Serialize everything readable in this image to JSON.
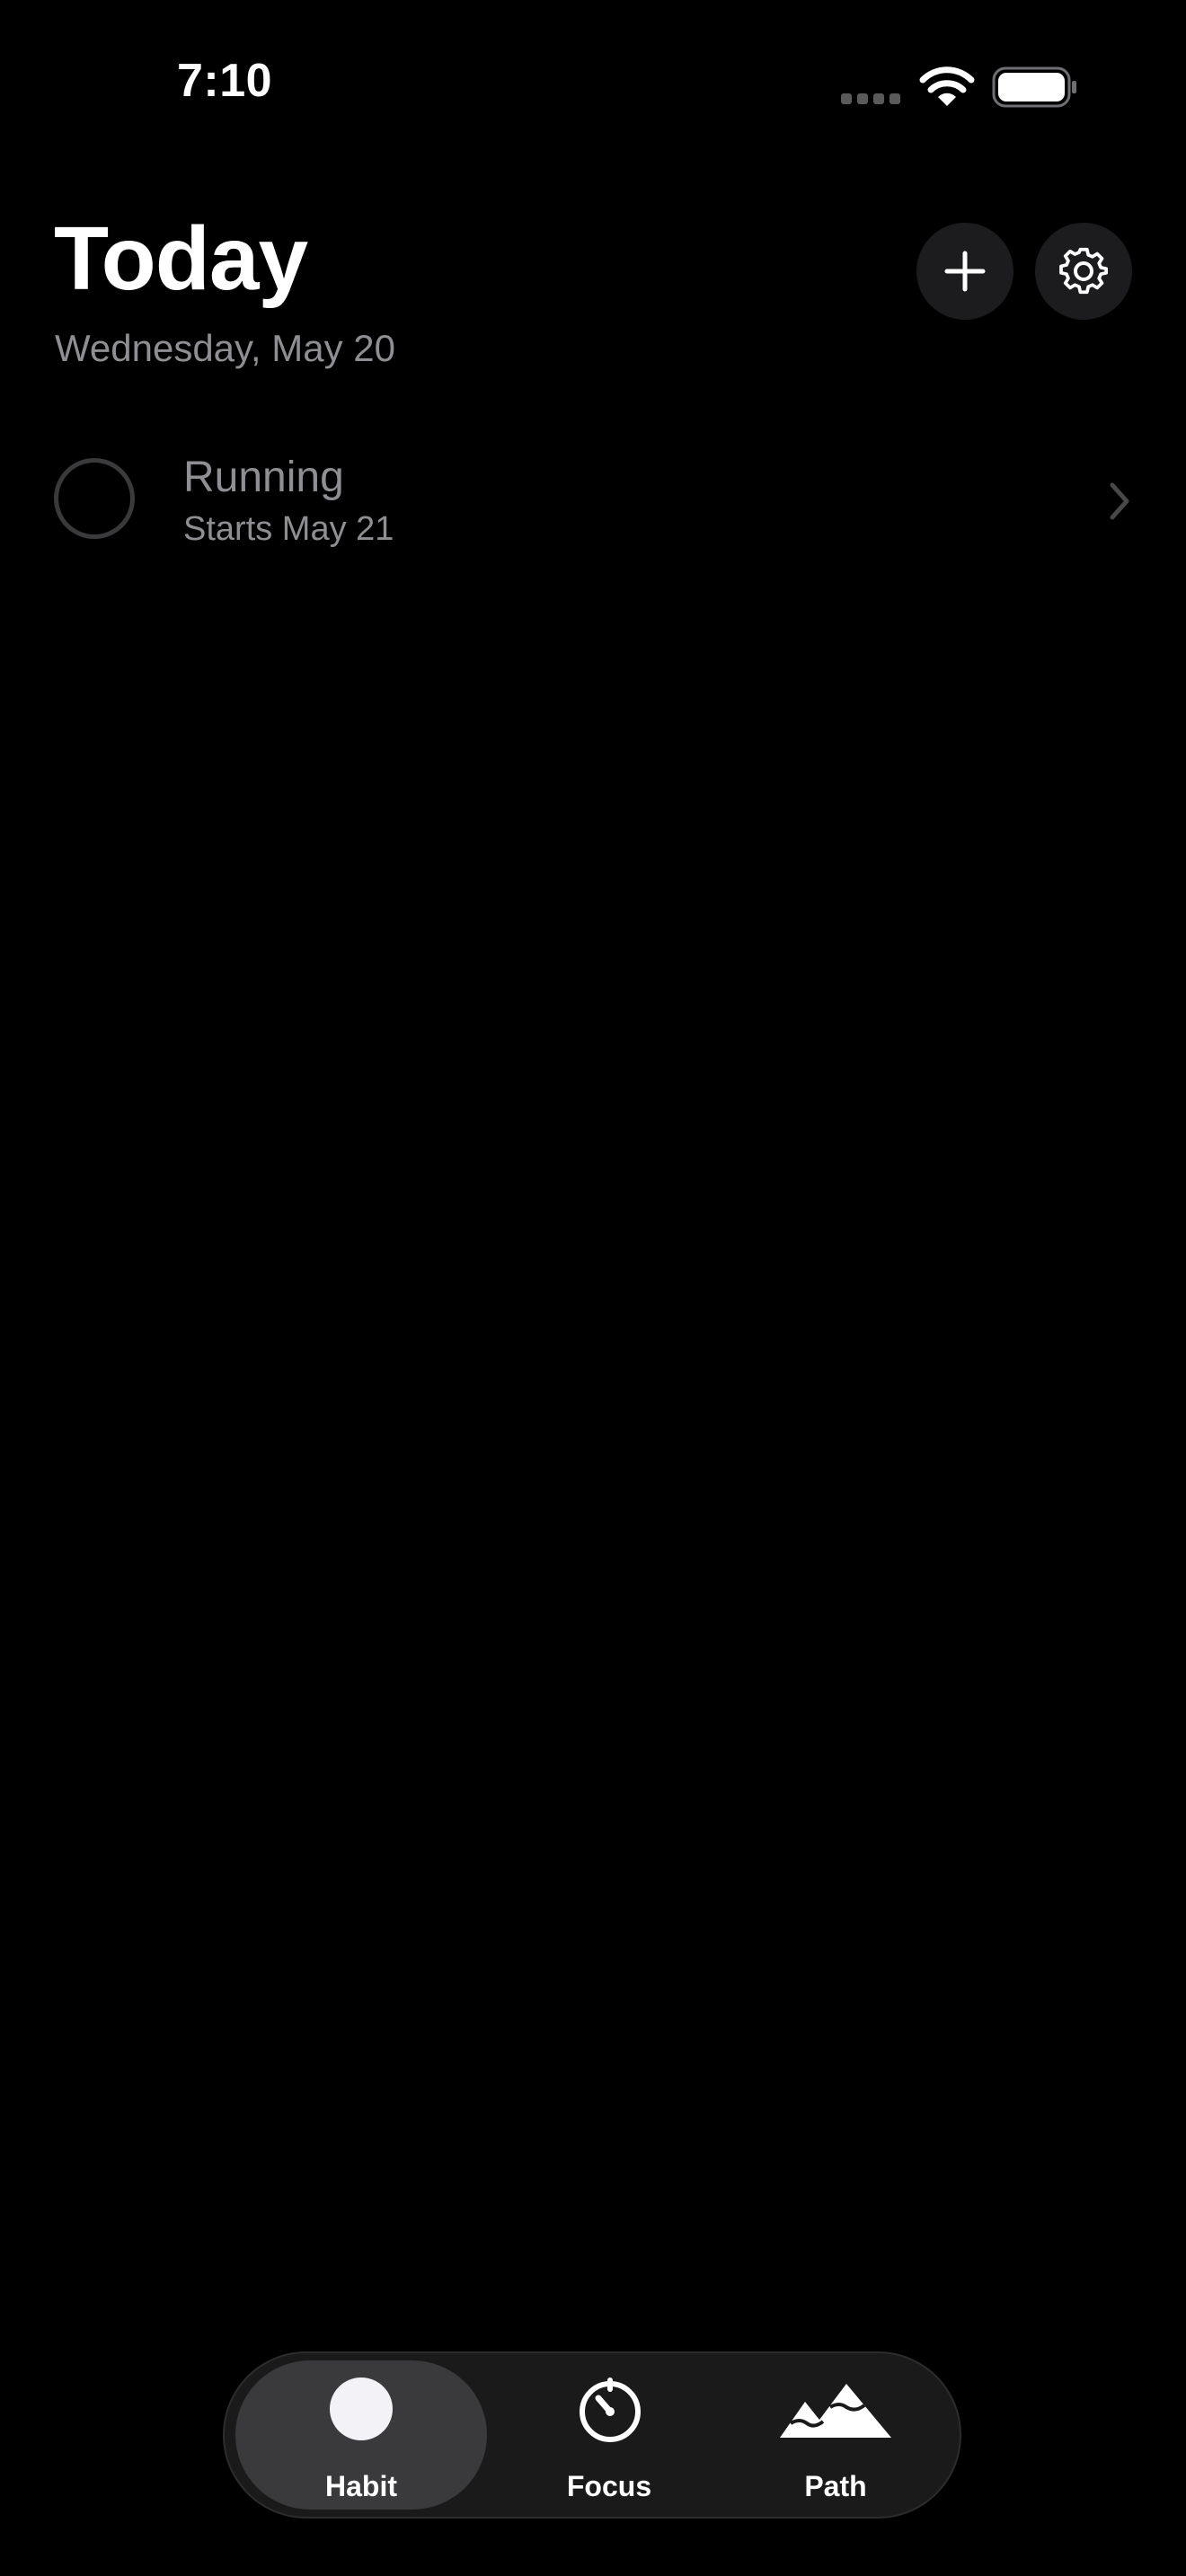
{
  "status_bar": {
    "time": "7:10"
  },
  "header": {
    "title": "Today",
    "date": "Wednesday, May 20",
    "add_icon": "plus-icon",
    "settings_icon": "gear-icon"
  },
  "habits": [
    {
      "name": "Running",
      "subtitle": "Starts May 21",
      "completed": false
    }
  ],
  "tab_bar": {
    "selected": "Habit",
    "tabs": [
      {
        "label": "Habit",
        "icon": "circle-icon"
      },
      {
        "label": "Focus",
        "icon": "timer-icon"
      },
      {
        "label": "Path",
        "icon": "mountain-icon"
      }
    ]
  },
  "colors": {
    "background": "#000000",
    "secondary_text": "#8e8e93",
    "button_fill": "#1c1c1e",
    "selected_tab": "#3a3a3c"
  }
}
